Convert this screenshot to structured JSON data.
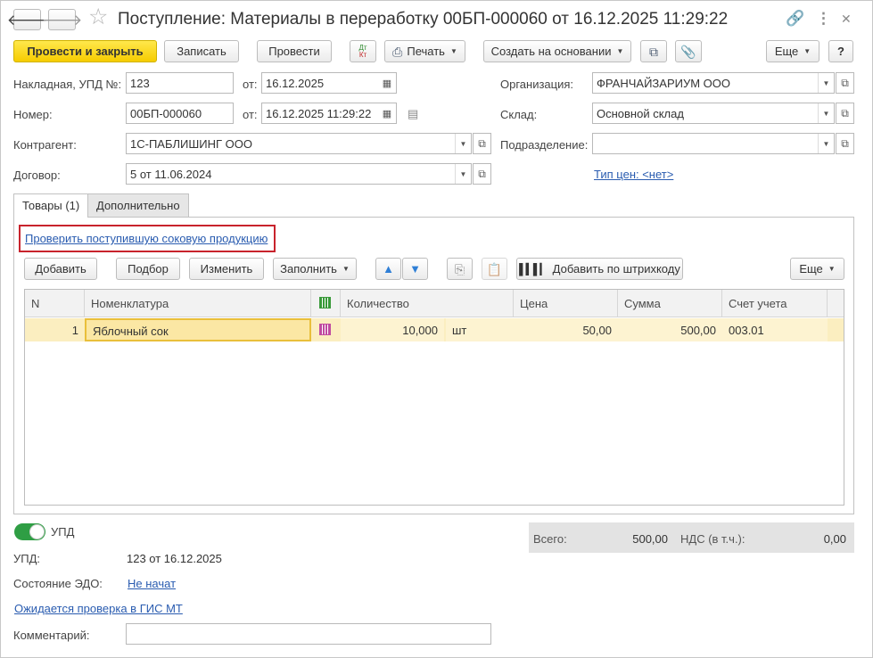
{
  "window": {
    "title": "Поступление: Материалы в переработку 00БП-000060 от 16.12.2025 11:29:22",
    "back_glyph": "🡐",
    "forward_glyph": "🡒",
    "star_glyph": "☆",
    "link_glyph": "🔗",
    "more_glyph": "⋮",
    "close_glyph": "✕"
  },
  "toolbar": {
    "post_close": "Провести и закрыть",
    "save": "Записать",
    "post": "Провести",
    "dtkt": "ДтКт",
    "print": "Печать",
    "create_based": "Создать на основании",
    "more": "Еще",
    "help": "?"
  },
  "form": {
    "invoice_label": "Накладная, УПД №:",
    "invoice_value": "123",
    "from_label": "от:",
    "invoice_date": "16.12.2025",
    "number_label": "Номер:",
    "number_value": "00БП-000060",
    "number_date": "16.12.2025 11:29:22",
    "contractor_label": "Контрагент:",
    "contractor_value": "1С-ПАБЛИШИНГ ООО",
    "contract_label": "Договор:",
    "contract_value": "5 от 11.06.2024",
    "org_label": "Организация:",
    "org_value": "ФРАНЧАЙЗАРИУМ ООО",
    "warehouse_label": "Склад:",
    "warehouse_value": "Основной склад",
    "division_label": "Подразделение:",
    "division_value": "",
    "price_type_link": "Тип цен: <нет>"
  },
  "tabs": [
    {
      "label": "Товары (1)"
    },
    {
      "label": "Дополнительно"
    }
  ],
  "goods": {
    "check_link": "Проверить поступившую соковую продукцию",
    "add": "Добавить",
    "selection": "Подбор",
    "edit": "Изменить",
    "fill": "Заполнить",
    "add_barcode": "Добавить по штрихкоду",
    "more": "Еще",
    "columns": [
      "N",
      "Номенклатура",
      "",
      "Количество",
      "",
      "Цена",
      "Сумма",
      "Счет учета"
    ],
    "rows": [
      {
        "n": "1",
        "item": "Яблочный сок",
        "qty": "10,000",
        "unit": "шт",
        "price": "50,00",
        "sum": "500,00",
        "account": "003.01"
      }
    ]
  },
  "footer": {
    "upd_toggle_label": "УПД",
    "upd_label": "УПД:",
    "upd_value": "123 от 16.12.2025",
    "edo_label": "Состояние ЭДО:",
    "edo_value": "Не начат",
    "gis_link": "Ожидается проверка в ГИС МТ",
    "comment_label": "Комментарий:",
    "comment_value": "",
    "total_label": "Всего:",
    "total_value": "500,00",
    "vat_label": "НДС (в т.ч.):",
    "vat_value": "0,00"
  },
  "colors": {
    "primary_button": "#f6cc00",
    "link": "#2a5cb0",
    "selected_row": "#fbeec0",
    "toggle_on": "#2f9e44",
    "highlight_box": "#c8232c"
  }
}
